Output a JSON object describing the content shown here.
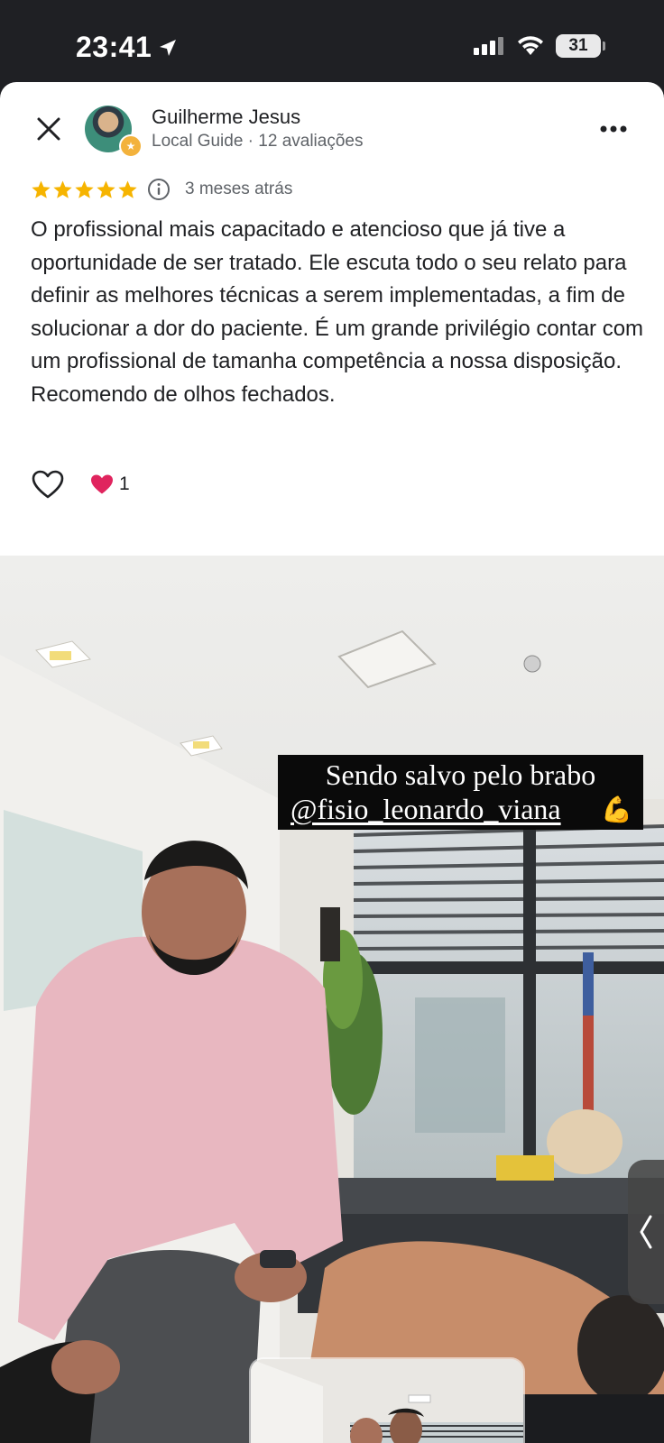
{
  "status_bar": {
    "time": "23:41",
    "battery": "31"
  },
  "review": {
    "reviewer_name": "Guilherme Jesus",
    "reviewer_meta": "Local Guide · 12 avaliações",
    "rating": 5,
    "date": "3 meses atrás",
    "text": "O profissional mais capacitado e atencioso que já tive a oportunidade de ser tratado. Ele escuta todo o seu relato para definir as melhores técnicas a serem implementadas, a fim de solucionar a dor do paciente. É um grande privilégio contar com um profissional de tamanha competência a nossa disposição. Recomendo de olhos fechados.",
    "reaction_count": "1"
  },
  "photo": {
    "caption_line1": "Sendo salvo pelo brabo",
    "caption_line2": "@fisio_leonardo_viana"
  },
  "icons": {
    "close": "close-icon",
    "more": "more-icon",
    "info": "info-icon",
    "like": "heart-outline-icon",
    "reaction": "heart-filled-icon",
    "side_handle": "chevron-left-icon"
  },
  "colors": {
    "star": "#F6B400",
    "reaction_heart": "#E0245E",
    "guide_badge": "#F3B23C"
  }
}
